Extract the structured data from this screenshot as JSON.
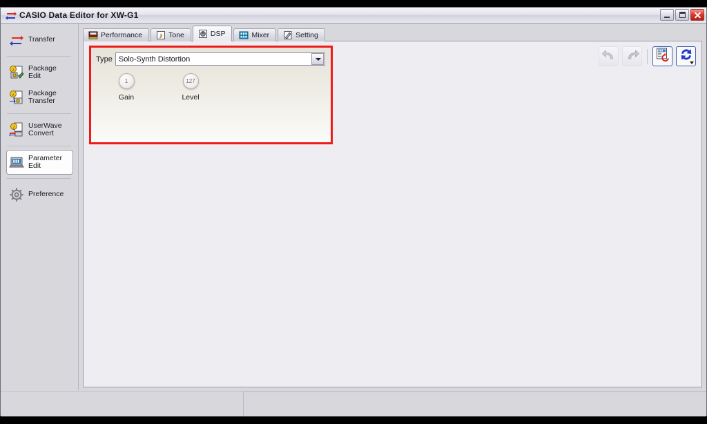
{
  "window": {
    "title": "CASIO Data Editor for XW-G1",
    "icon": "casio-transfer-icon",
    "controls": {
      "minimize": "Minimize",
      "maximize": "Maximize",
      "close": "Close"
    }
  },
  "sidebar": {
    "items": [
      {
        "label_line1": "Transfer",
        "label_line2": "",
        "icon": "transfer-arrows-icon",
        "selected": false
      },
      {
        "label_line1": "Package",
        "label_line2": "Edit",
        "icon": "package-edit-icon",
        "selected": false
      },
      {
        "label_line1": "Package",
        "label_line2": "Transfer",
        "icon": "package-transfer-icon",
        "selected": false
      },
      {
        "label_line1": "UserWave",
        "label_line2": "Convert",
        "icon": "userwave-convert-icon",
        "selected": false
      },
      {
        "label_line1": "Parameter",
        "label_line2": "Edit",
        "icon": "parameter-edit-icon",
        "selected": true
      },
      {
        "label_line1": "Preference",
        "label_line2": "",
        "icon": "gear-icon",
        "selected": false
      }
    ]
  },
  "tabs": [
    {
      "label": "Performance",
      "icon": "performance-icon",
      "active": false
    },
    {
      "label": "Tone",
      "icon": "tone-icon",
      "active": false
    },
    {
      "label": "DSP",
      "icon": "dsp-icon",
      "active": true
    },
    {
      "label": "Mixer",
      "icon": "mixer-icon",
      "active": false
    },
    {
      "label": "Setting",
      "icon": "setting-icon",
      "active": false
    }
  ],
  "toolbar": {
    "undo": {
      "name": "undo-button",
      "icon": "undo-arrow-icon",
      "enabled": false
    },
    "redo": {
      "name": "redo-button",
      "icon": "redo-arrow-icon",
      "enabled": false
    },
    "restore": {
      "name": "restore-defaults-button",
      "icon": "panel-restore-icon",
      "enabled": true
    },
    "sync": {
      "name": "sync-button",
      "icon": "blue-sync-arrows-icon",
      "enabled": true
    }
  },
  "dsp": {
    "type_label": "Type",
    "type_value": "Solo-Synth Distortion",
    "border_color": "#ee1b1b",
    "knobs": [
      {
        "label": "Gain",
        "value": "1"
      },
      {
        "label": "Level",
        "value": "127"
      }
    ]
  },
  "colors": {
    "accent_red": "#ee1b1b",
    "accent_blue": "#1e38c8",
    "window_bg": "#d7d7dc",
    "panel_bg": "#ededf2"
  }
}
